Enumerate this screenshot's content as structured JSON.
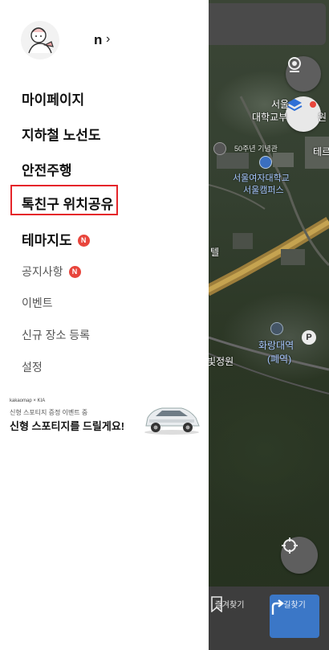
{
  "profile": {
    "username": "n",
    "chevron": "›"
  },
  "menu": {
    "items": [
      {
        "label": "마이페이지"
      },
      {
        "label": "지하철 노선도"
      },
      {
        "label": "안전주행"
      },
      {
        "label": "톡친구 위치공유"
      },
      {
        "label": "테마지도",
        "badge": "N"
      },
      {
        "label": "공지사항",
        "badge": "N"
      },
      {
        "label": "이벤트"
      },
      {
        "label": "신규 장소 등록"
      },
      {
        "label": "설정"
      }
    ]
  },
  "ad": {
    "brand": "kakaomap × KIA",
    "subtitle": "신형 스포티지 증정 이벤트 중",
    "title": "신형 스포티지를 드릴게요!"
  },
  "map": {
    "labels": {
      "seoul": "서울",
      "univ_partial": "대학교부",
      "won": "원",
      "te": "테르",
      "anniversary_hall": "50주년 기념관",
      "swu_line1": "서울여자대학교",
      "swu_line2": "서울캠퍼스",
      "tel": "텔",
      "hwarang_station": "화랑대역",
      "closed": "(폐역)",
      "park_partial": "빛정원"
    },
    "parking_symbol": "P"
  },
  "bottom": {
    "favorites_label": "즐겨찾기",
    "route_label": "길찾기"
  },
  "colors": {
    "highlight": "#e5252a",
    "badge": "#e8453c",
    "route_button": "#3b77c7"
  }
}
